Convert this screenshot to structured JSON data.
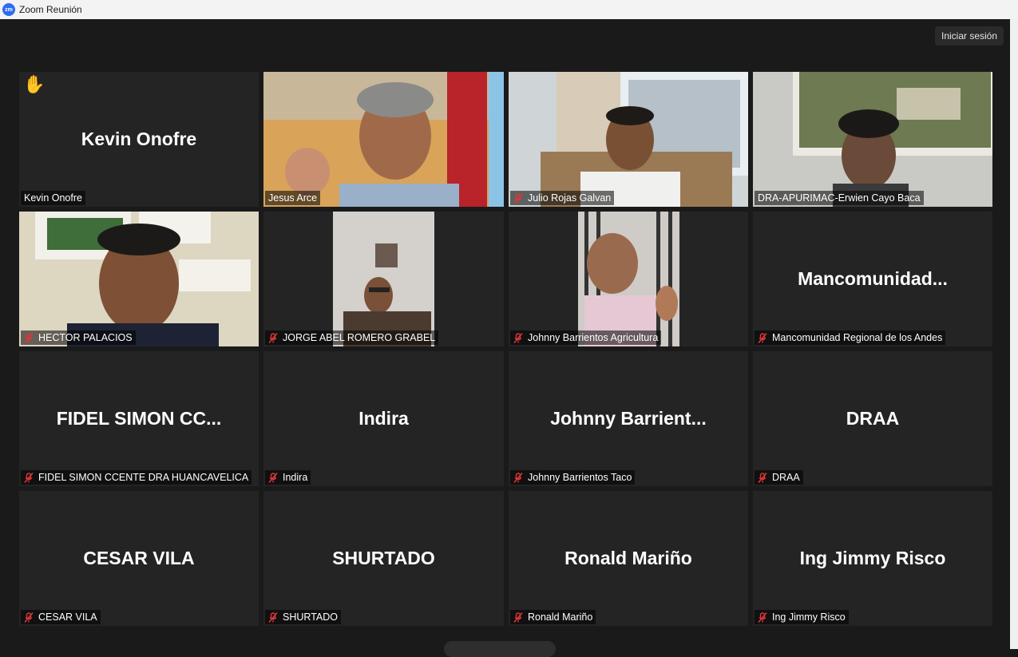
{
  "window": {
    "title": "Zoom Reunión",
    "logo_text": "zm"
  },
  "header": {
    "signin_label": "Iniciar sesión"
  },
  "participants": [
    {
      "display": "Kevin Onofre",
      "name": "Kevin Onofre",
      "muted": false,
      "video": false,
      "hand_raised": true
    },
    {
      "display": "",
      "name": "Jesus Arce",
      "muted": false,
      "video": true,
      "active_speaker": true
    },
    {
      "display": "",
      "name": "Julio Rojas Galvan",
      "muted": true,
      "video": true
    },
    {
      "display": "",
      "name": "DRA-APURIMAC-Erwien Cayo Baca",
      "muted": false,
      "video": true
    },
    {
      "display": "",
      "name": "HECTOR PALACIOS",
      "muted": true,
      "video": true
    },
    {
      "display": "",
      "name": "JORGE ABEL ROMERO GRABEL",
      "muted": true,
      "video": true
    },
    {
      "display": "",
      "name": "Johnny Barrientos Agricultura",
      "muted": true,
      "video": true
    },
    {
      "display": "Mancomunidad...",
      "name": "Mancomunidad Regional de los Andes",
      "muted": true,
      "video": false
    },
    {
      "display": "FIDEL SIMON CC...",
      "name": "FIDEL SIMON CCENTE DRA HUANCAVELICA",
      "muted": true,
      "video": false
    },
    {
      "display": "Indira",
      "name": "Indira",
      "muted": true,
      "video": false
    },
    {
      "display": "Johnny Barrient...",
      "name": "Johnny Barrientos Taco",
      "muted": true,
      "video": false
    },
    {
      "display": "DRAA",
      "name": "DRAA",
      "muted": true,
      "video": false
    },
    {
      "display": "CESAR VILA",
      "name": "CESAR VILA",
      "muted": true,
      "video": false
    },
    {
      "display": "SHURTADO",
      "name": "SHURTADO",
      "muted": true,
      "video": false
    },
    {
      "display": "Ronald Mariño",
      "name": "Ronald Mariño",
      "muted": true,
      "video": false
    },
    {
      "display": "Ing Jimmy Risco",
      "name": "Ing Jimmy Risco",
      "muted": true,
      "video": false
    }
  ],
  "colors": {
    "active_border": "#c8dc6e",
    "muted_icon": "#e0363a",
    "tile_bg": "#242424"
  }
}
